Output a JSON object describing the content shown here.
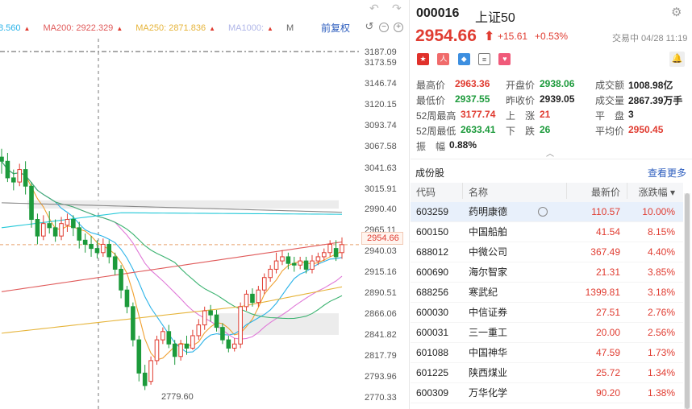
{
  "chart": {
    "ma_items": [
      {
        "label": "8.560",
        "color": "#2bb3e8"
      },
      {
        "label": "MA200: 2922.329",
        "color": "#e05a5a"
      },
      {
        "label": "MA250: 2871.836",
        "color": "#e6b43a"
      },
      {
        "label": "MA1000:",
        "color": "#b0b6e8"
      },
      {
        "label": "M",
        "color": "#666666"
      }
    ],
    "fq_label": "前复权",
    "y_labels": [
      "3187.09",
      "3173.59",
      "3146.74",
      "3120.15",
      "3093.74",
      "3067.58",
      "3041.63",
      "3015.91",
      "2990.40",
      "2965.11",
      "2940.03",
      "2915.16",
      "2890.51",
      "2866.06",
      "2841.82",
      "2817.79",
      "2793.96",
      "2770.33"
    ],
    "current_price": "2954.66",
    "low_label": "2779.60"
  },
  "chart_data": {
    "type": "candlestick",
    "y_ticks": [
      3187.09,
      3173.59,
      3146.74,
      3120.15,
      3093.74,
      3067.58,
      3041.63,
      3015.91,
      2990.4,
      2965.11,
      2940.03,
      2915.16,
      2890.51,
      2866.06,
      2841.82,
      2817.79,
      2793.96,
      2770.33
    ],
    "current": 2954.66,
    "low": 2779.6,
    "colors": {
      "up": "#e03c31",
      "down": "#1c9a3b",
      "ma200": "#e05a5a",
      "ma250": "#e6b43a",
      "ma1000": "#b0b6e8",
      "ma_blue": "#2bb3e8",
      "ma_orange": "#f0a030",
      "ma_pink": "#e07ad8",
      "ma_green": "#3cb371",
      "ma_gray": "#888888",
      "ma_cyan": "#22c8d8"
    },
    "candles": [
      [
        3060,
        3055,
        3070,
        3040
      ],
      [
        3055,
        3035,
        3065,
        3030
      ],
      [
        3035,
        3030,
        3045,
        3020
      ],
      [
        3030,
        3045,
        3052,
        3025
      ],
      [
        3045,
        3025,
        3055,
        3015
      ],
      [
        3025,
        2985,
        3030,
        2975
      ],
      [
        2985,
        2965,
        2992,
        2955
      ],
      [
        2965,
        2980,
        2990,
        2960
      ],
      [
        2980,
        2975,
        2995,
        2968
      ],
      [
        2975,
        2965,
        2985,
        2958
      ],
      [
        2965,
        2980,
        2988,
        2960
      ],
      [
        2978,
        2985,
        2992,
        2970
      ],
      [
        2985,
        2975,
        2990,
        2965
      ],
      [
        2975,
        2960,
        2982,
        2950
      ],
      [
        2960,
        2955,
        2968,
        2945
      ],
      [
        2955,
        2950,
        2965,
        2940
      ],
      [
        2950,
        2945,
        2960,
        2938
      ],
      [
        2945,
        2955,
        2962,
        2940
      ],
      [
        2955,
        2940,
        2960,
        2932
      ],
      [
        2940,
        2925,
        2945,
        2918
      ],
      [
        2925,
        2900,
        2930,
        2890
      ],
      [
        2900,
        2880,
        2905,
        2872
      ],
      [
        2880,
        2840,
        2885,
        2832
      ],
      [
        2840,
        2800,
        2845,
        2790
      ],
      [
        2800,
        2785,
        2810,
        2779.6
      ],
      [
        2790,
        2815,
        2820,
        2786
      ],
      [
        2815,
        2840,
        2845,
        2810
      ],
      [
        2840,
        2850,
        2855,
        2835
      ],
      [
        2850,
        2835,
        2858,
        2830
      ],
      [
        2835,
        2820,
        2840,
        2810
      ],
      [
        2820,
        2835,
        2840,
        2815
      ],
      [
        2835,
        2830,
        2845,
        2822
      ],
      [
        2830,
        2845,
        2852,
        2828
      ],
      [
        2845,
        2858,
        2865,
        2840
      ],
      [
        2858,
        2875,
        2880,
        2852
      ],
      [
        2875,
        2870,
        2882,
        2862
      ],
      [
        2870,
        2855,
        2876,
        2850
      ],
      [
        2855,
        2840,
        2860,
        2835
      ],
      [
        2840,
        2830,
        2845,
        2825
      ],
      [
        2830,
        2835,
        2842,
        2826
      ],
      [
        2835,
        2880,
        2885,
        2830
      ],
      [
        2880,
        2895,
        2900,
        2875
      ],
      [
        2895,
        2885,
        2902,
        2880
      ],
      [
        2885,
        2900,
        2905,
        2880
      ],
      [
        2900,
        2915,
        2920,
        2895
      ],
      [
        2915,
        2925,
        2930,
        2910
      ],
      [
        2925,
        2935,
        2945,
        2920
      ],
      [
        2935,
        2940,
        2948,
        2930
      ],
      [
        2940,
        2932,
        2945,
        2925
      ],
      [
        2932,
        2930,
        2940,
        2922
      ],
      [
        2930,
        2935,
        2940,
        2925
      ],
      [
        2935,
        2925,
        2940,
        2920
      ],
      [
        2925,
        2935,
        2942,
        2920
      ],
      [
        2935,
        2940,
        2945,
        2930
      ],
      [
        2940,
        2945,
        2950,
        2935
      ],
      [
        2945,
        2955,
        2960,
        2940
      ],
      [
        2950,
        2940,
        2960,
        2935
      ],
      [
        2945,
        2954.66,
        2963.36,
        2937.55
      ]
    ]
  },
  "info": {
    "code": "000016",
    "name": "上证50",
    "price": "2954.66",
    "change": "+15.61",
    "change_pct": "+0.53%",
    "status": "交易中 04/28 11:19",
    "quote_left": [
      {
        "k": "最高价",
        "v": "2963.36",
        "c": "r"
      },
      {
        "k": "最低价",
        "v": "2937.55",
        "c": "g"
      },
      {
        "k": "52周最高",
        "v": "3177.74",
        "c": "r"
      },
      {
        "k": "52周最低",
        "v": "2633.41",
        "c": "g"
      },
      {
        "k": "振　幅",
        "v": "0.88%",
        "c": "k"
      }
    ],
    "quote_mid": [
      {
        "k": "开盘价",
        "v": "2938.06",
        "c": "g"
      },
      {
        "k": "昨收价",
        "v": "2939.05",
        "c": "k"
      },
      {
        "k": "上　涨",
        "v": "21",
        "c": "r"
      },
      {
        "k": "下　跌",
        "v": "26",
        "c": "g"
      }
    ],
    "quote_right": [
      {
        "k": "成交额",
        "v": "1008.98亿",
        "c": "k"
      },
      {
        "k": "成交量",
        "v": "2867.39万手",
        "c": "k"
      },
      {
        "k": "平　盘",
        "v": "3",
        "c": "k"
      },
      {
        "k": "平均价",
        "v": "2950.45",
        "c": "r"
      }
    ]
  },
  "constituents": {
    "title": "成份股",
    "more": "查看更多",
    "headers": [
      "代码",
      "名称",
      "最新价",
      "涨跌幅 ▾"
    ],
    "rows": [
      {
        "code": "603259",
        "name": "药明康德",
        "price": "110.57",
        "pct": "10.00%"
      },
      {
        "code": "600150",
        "name": "中国船舶",
        "price": "41.54",
        "pct": "8.15%"
      },
      {
        "code": "688012",
        "name": "中微公司",
        "price": "367.49",
        "pct": "4.40%"
      },
      {
        "code": "600690",
        "name": "海尔智家",
        "price": "21.31",
        "pct": "3.85%"
      },
      {
        "code": "688256",
        "name": "寒武纪",
        "price": "1399.81",
        "pct": "3.18%"
      },
      {
        "code": "600030",
        "name": "中信证券",
        "price": "27.51",
        "pct": "2.76%"
      },
      {
        "code": "600031",
        "name": "三一重工",
        "price": "20.00",
        "pct": "2.56%"
      },
      {
        "code": "601088",
        "name": "中国神华",
        "price": "47.59",
        "pct": "1.73%"
      },
      {
        "code": "601225",
        "name": "陕西煤业",
        "price": "25.72",
        "pct": "1.34%"
      },
      {
        "code": "600309",
        "name": "万华化学",
        "price": "90.20",
        "pct": "1.38%"
      }
    ]
  }
}
